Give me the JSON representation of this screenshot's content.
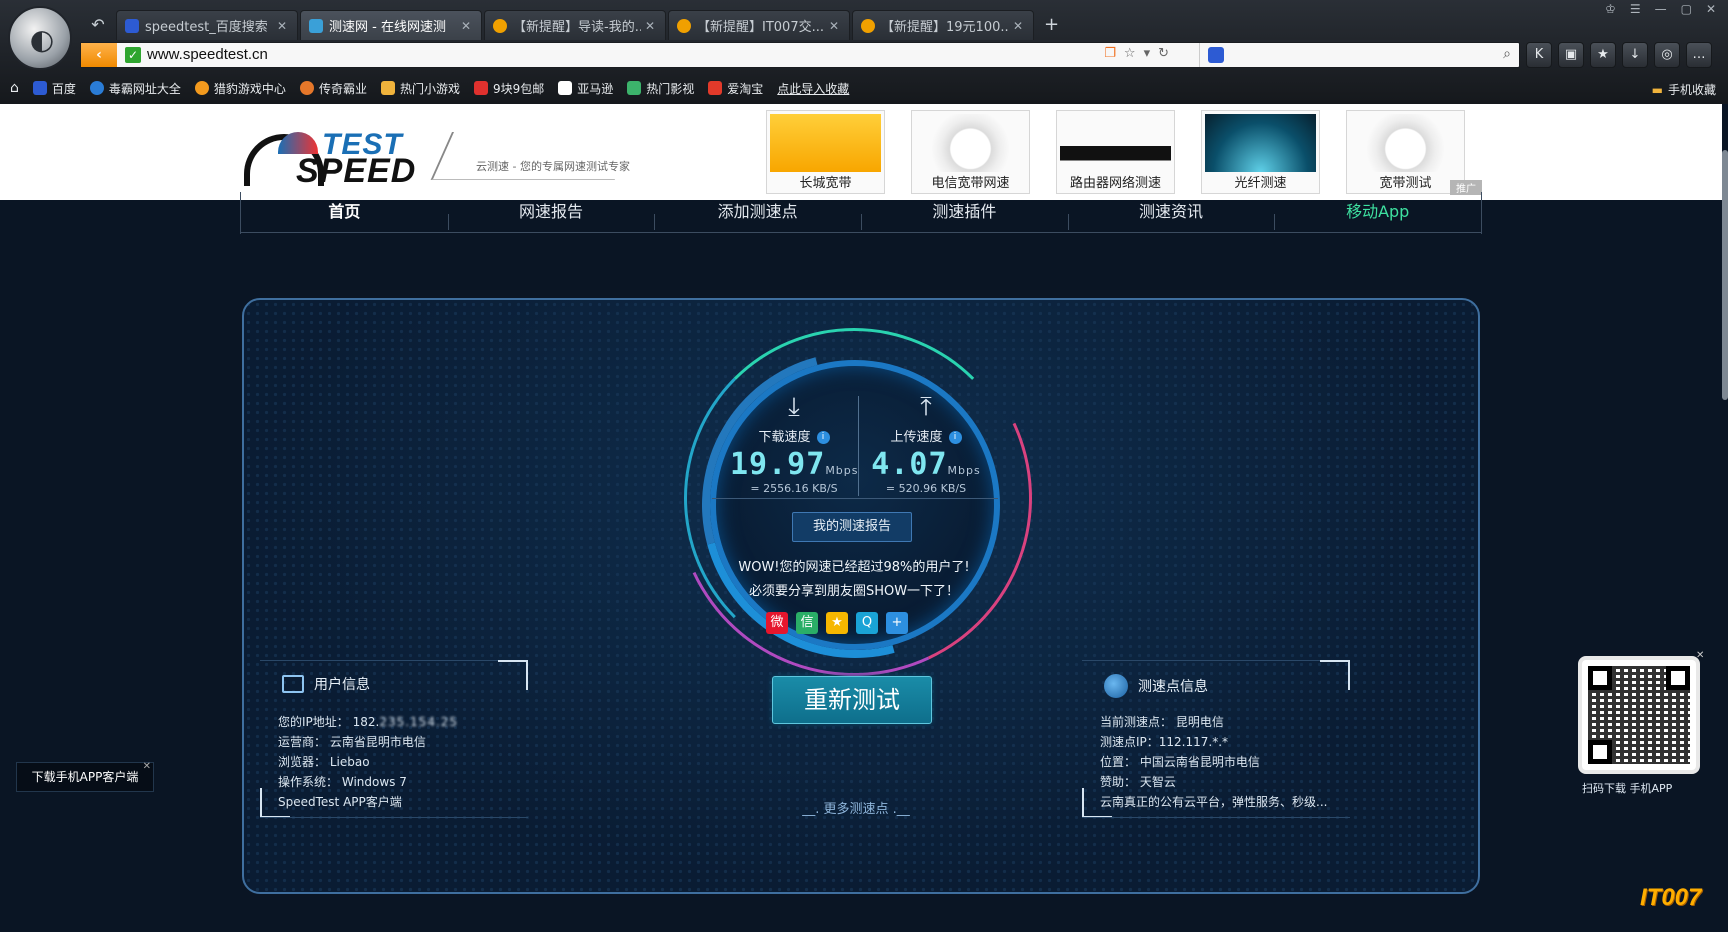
{
  "browser": {
    "tabs": [
      {
        "label": "speedtest_百度搜索",
        "color": "#2d5bd3"
      },
      {
        "label": "测速网 - 在线网速测",
        "color": "#3aa0d8"
      },
      {
        "label": "【新提醒】导读-我的...",
        "color": "#f0a000"
      },
      {
        "label": "【新提醒】IT007交...",
        "color": "#f0a000"
      },
      {
        "label": "【新提醒】19元100...",
        "color": "#f0a000"
      }
    ],
    "new_tab": "+",
    "url": "www.speedtest.cn",
    "bookmarks": [
      {
        "label": "百度",
        "color": "#2d5bd3"
      },
      {
        "label": "毒霸网址大全",
        "color": "#2a7cd6"
      },
      {
        "label": "猎豹游戏中心",
        "color": "#f39a1e"
      },
      {
        "label": "传奇霸业",
        "color": "#e5772a"
      },
      {
        "label": "热门小游戏",
        "color": "#f0b33c"
      },
      {
        "label": "9块9包邮",
        "color": "#e0312e"
      },
      {
        "label": "亚马逊",
        "color": "#222222"
      },
      {
        "label": "热门影视",
        "color": "#3cb36b"
      },
      {
        "label": "爱淘宝",
        "color": "#e33a2a"
      },
      {
        "label": "点此导入收藏",
        "color": ""
      }
    ],
    "mobile_fav": "手机收藏"
  },
  "site": {
    "tagline": "云测速 - 您的专属网速测试专家",
    "logo_test": "TEST",
    "logo_speed": "SPEED",
    "ads": [
      {
        "label": "长城宽带"
      },
      {
        "label": "电信宽带网速"
      },
      {
        "label": "路由器网络测速"
      },
      {
        "label": "光纤测速"
      },
      {
        "label": "宽带测试"
      }
    ],
    "ad_tag": "推广",
    "nav": [
      "首页",
      "网速报告",
      "添加测速点",
      "测速插件",
      "测速资讯",
      "移动App"
    ]
  },
  "result": {
    "download": {
      "label": "下载速度",
      "value": "19.97",
      "unit": "Mbps",
      "kbs": "= 2556.16  KB/S"
    },
    "upload": {
      "label": "上传速度",
      "value": "4.07",
      "unit": "Mbps",
      "kbs": "= 520.96  KB/S"
    },
    "report_button": "我的测速报告",
    "wow_line1": "WOW!您的网速已经超过98%的用户了!",
    "wow_line2": "必须要分享到朋友圈SHOW一下了！",
    "retest": "重新测试",
    "more": "__. 更多测速点 .__"
  },
  "user_info": {
    "title": "用户信息",
    "ip_label": "您的IP地址：",
    "ip_value": "182.",
    "isp_label": "运营商：",
    "isp_value": "云南省昆明市电信",
    "browser_label": "浏览器：",
    "browser_value": "Liebao",
    "os_label": "操作系统：",
    "os_value": "Windows 7",
    "app": "SpeedTest APP客户端"
  },
  "node_info": {
    "title": "测速点信息",
    "node_label": "当前测速点：",
    "node_value": "昆明电信",
    "ip_label": "测速点IP：",
    "ip_value": "112.117.*.*",
    "loc_label": "位置：",
    "loc_value": "中国云南省昆明市电信",
    "sponsor_label": "赞助：",
    "sponsor_value": "天智云",
    "desc": "云南真正的公有云平台，弹性服务、秒级..."
  },
  "floating": {
    "app_download": "下载手机APP客户端",
    "qr_label": "扫码下载 手机APP",
    "watermark": "IT007"
  }
}
